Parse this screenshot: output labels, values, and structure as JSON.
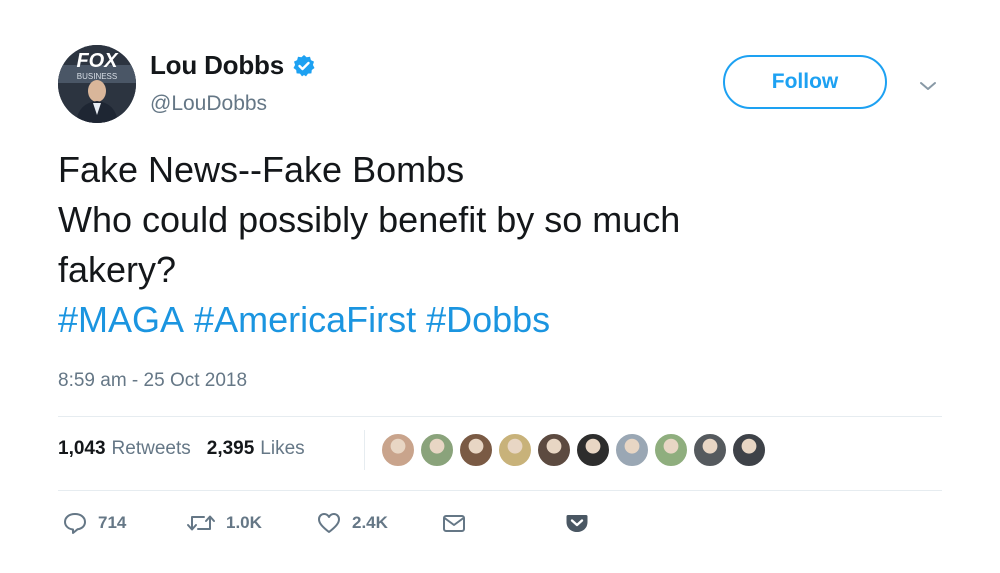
{
  "user": {
    "display_name": "Lou Dobbs",
    "handle": "@LouDobbs",
    "avatar_logo_text": "FOX",
    "avatar_sub_text": "BUSINESS"
  },
  "follow_button": {
    "label": "Follow"
  },
  "tweet": {
    "lines": [
      "Fake News--Fake Bombs",
      "Who could possibly benefit by so much",
      "fakery?"
    ],
    "hashtags": [
      "#MAGA",
      "#AmericaFirst",
      "#Dobbs"
    ]
  },
  "timestamp": "8:59 am - 25 Oct 2018",
  "stats": {
    "retweets_count": "1,043",
    "retweets_label": "Retweets",
    "likes_count": "2,395",
    "likes_label": "Likes"
  },
  "likers": [
    {
      "icon": "liker-avatar-1",
      "color": "#c9a48c"
    },
    {
      "icon": "liker-avatar-2",
      "color": "#8aa37b"
    },
    {
      "icon": "liker-avatar-3",
      "color": "#7a5a44"
    },
    {
      "icon": "liker-avatar-4",
      "color": "#c8b27a"
    },
    {
      "icon": "liker-avatar-5",
      "color": "#5c4a40"
    },
    {
      "icon": "liker-avatar-6",
      "color": "#2d2d2d"
    },
    {
      "icon": "liker-avatar-7",
      "color": "#9aa7b4"
    },
    {
      "icon": "liker-avatar-8",
      "color": "#8fae7e"
    },
    {
      "icon": "liker-avatar-9",
      "color": "#555a5e"
    },
    {
      "icon": "liker-avatar-10",
      "color": "#3e4248"
    }
  ],
  "actions": {
    "replies": "714",
    "retweets": "1.0K",
    "likes": "2.4K"
  },
  "colors": {
    "accent": "#1da1f2",
    "link": "#1b95e0",
    "muted": "#657786",
    "text": "#14171a"
  }
}
